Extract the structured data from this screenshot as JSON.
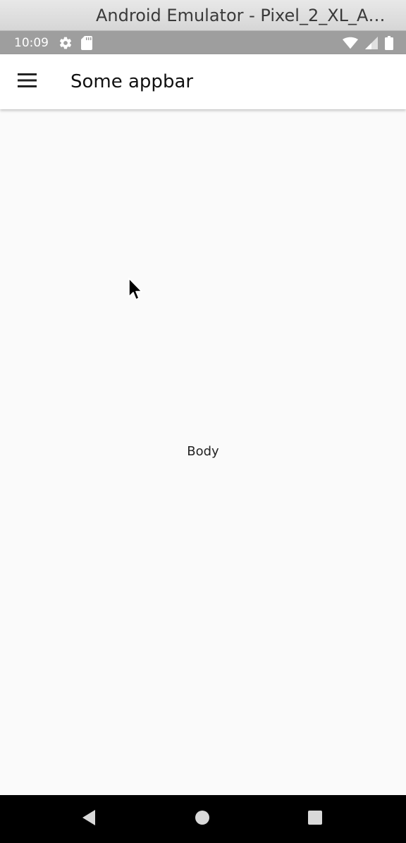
{
  "window": {
    "title": "Android Emulator - Pixel_2_XL_AP..."
  },
  "status_bar": {
    "time": "10:09",
    "icons": [
      "settings-icon",
      "sd-card-icon",
      "wifi-icon",
      "cell-signal-icon",
      "battery-icon"
    ]
  },
  "app_bar": {
    "menu_icon": "menu-icon",
    "title": "Some appbar"
  },
  "body": {
    "text": "Body"
  },
  "nav_bar": {
    "buttons": [
      "back-icon",
      "home-icon",
      "recents-icon"
    ]
  },
  "colors": {
    "status_bar": "#9e9e9e",
    "app_bar": "#ffffff",
    "background": "#fafafa",
    "nav_bar": "#000000"
  }
}
